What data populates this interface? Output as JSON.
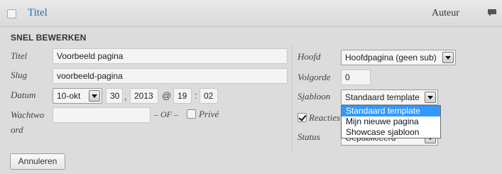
{
  "header": {
    "title": "Titel",
    "author_col": "Auteur"
  },
  "quick_edit": {
    "section_title": "SNEL BEWERKEN",
    "title_label": "Titel",
    "title_value": "Voorbeeld pagina",
    "slug_label": "Slug",
    "slug_value": "voorbeeld-pagina",
    "date_label": "Datum",
    "month_value": "10-okt",
    "day_value": "30",
    "year_value": "2013",
    "at_sep": "@",
    "hour_value": "19",
    "time_sep": ":",
    "minute_value": "02",
    "date_comma": ",",
    "password_label_line1": "Wachtwo",
    "password_label_line2": "ord",
    "password_value": "",
    "or_text": "– OF –",
    "private_label": "Privé",
    "parent_label": "Hoofd",
    "parent_value": "Hoofdpagina (geen sub)",
    "order_label": "Volgorde",
    "order_value": "0",
    "template_label": "Sjabloon",
    "template_value": "Standaard template",
    "template_options": [
      "Standaard template",
      "Mijn nieuwe pagina",
      "Showcase sjabloon"
    ],
    "comments_label": "Reacties",
    "status_label": "Status",
    "status_value": "Gepubliceerd",
    "cancel_label": "Annuleren"
  }
}
